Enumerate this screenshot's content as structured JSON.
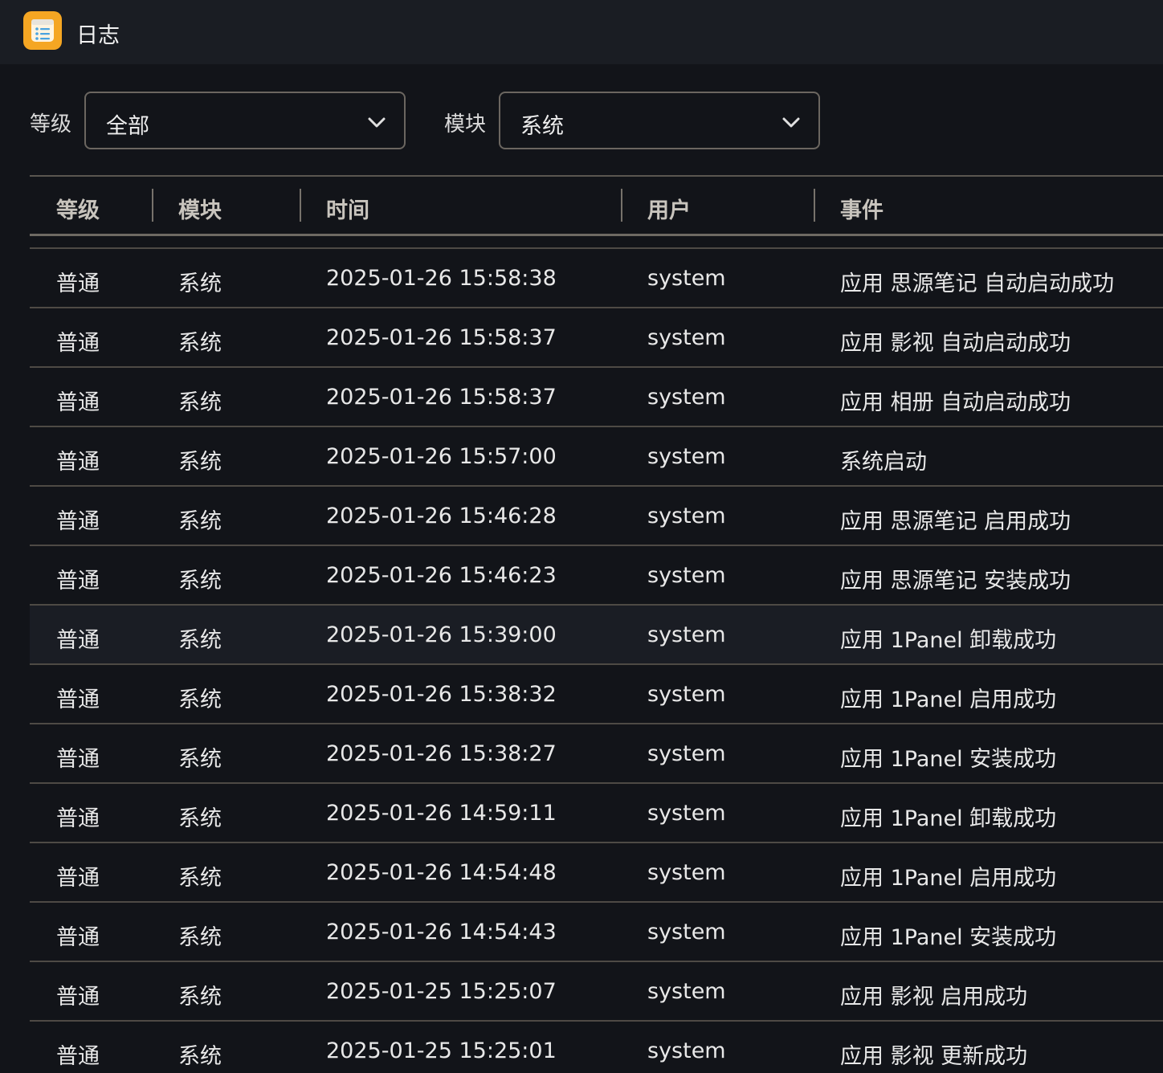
{
  "app": {
    "title": "日志",
    "icon": "notes-list-icon",
    "accent": "#f5a623"
  },
  "filters": {
    "level_label": "等级",
    "level_value": "全部",
    "module_label": "模块",
    "module_value": "系统"
  },
  "table": {
    "headers": [
      "等级",
      "模块",
      "时间",
      "用户",
      "事件"
    ],
    "rows": [
      {
        "level": "普通",
        "module": "系统",
        "time": "2025-01-26 15:58:38",
        "user": "system",
        "event": "应用 思源笔记 自动启动成功"
      },
      {
        "level": "普通",
        "module": "系统",
        "time": "2025-01-26 15:58:37",
        "user": "system",
        "event": "应用 影视 自动启动成功"
      },
      {
        "level": "普通",
        "module": "系统",
        "time": "2025-01-26 15:58:37",
        "user": "system",
        "event": "应用 相册 自动启动成功"
      },
      {
        "level": "普通",
        "module": "系统",
        "time": "2025-01-26 15:57:00",
        "user": "system",
        "event": "系统启动"
      },
      {
        "level": "普通",
        "module": "系统",
        "time": "2025-01-26 15:46:28",
        "user": "system",
        "event": "应用 思源笔记 启用成功"
      },
      {
        "level": "普通",
        "module": "系统",
        "time": "2025-01-26 15:46:23",
        "user": "system",
        "event": "应用 思源笔记 安装成功"
      },
      {
        "level": "普通",
        "module": "系统",
        "time": "2025-01-26 15:39:00",
        "user": "system",
        "event": "应用 1Panel 卸载成功"
      },
      {
        "level": "普通",
        "module": "系统",
        "time": "2025-01-26 15:38:32",
        "user": "system",
        "event": "应用 1Panel 启用成功"
      },
      {
        "level": "普通",
        "module": "系统",
        "time": "2025-01-26 15:38:27",
        "user": "system",
        "event": "应用 1Panel 安装成功"
      },
      {
        "level": "普通",
        "module": "系统",
        "time": "2025-01-26 14:59:11",
        "user": "system",
        "event": "应用 1Panel 卸载成功"
      },
      {
        "level": "普通",
        "module": "系统",
        "time": "2025-01-26 14:54:48",
        "user": "system",
        "event": "应用 1Panel 启用成功"
      },
      {
        "level": "普通",
        "module": "系统",
        "time": "2025-01-26 14:54:43",
        "user": "system",
        "event": "应用 1Panel 安装成功"
      },
      {
        "level": "普通",
        "module": "系统",
        "time": "2025-01-25 15:25:07",
        "user": "system",
        "event": "应用 影视 启用成功"
      },
      {
        "level": "普通",
        "module": "系统",
        "time": "2025-01-25 15:25:01",
        "user": "system",
        "event": "应用 影视 更新成功"
      }
    ]
  }
}
